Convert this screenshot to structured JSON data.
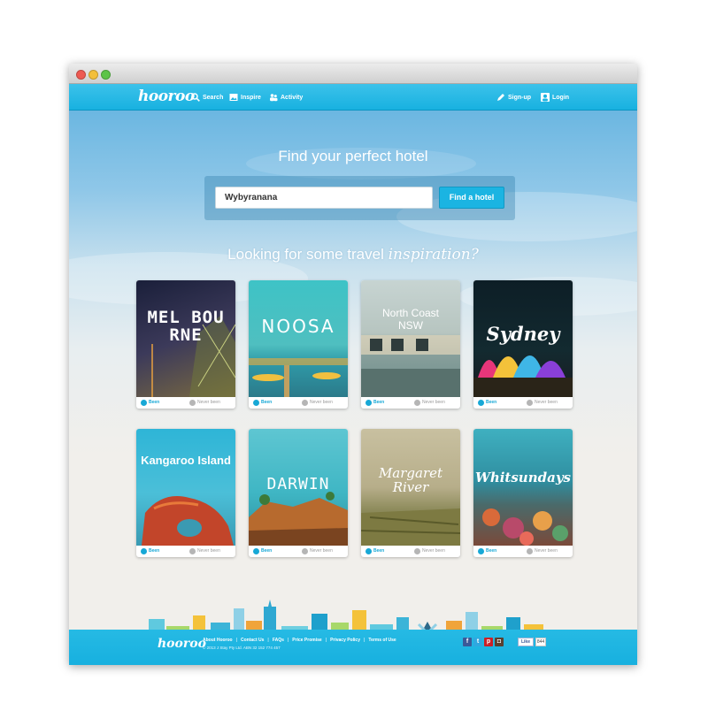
{
  "nav": {
    "logo": "hooroo",
    "search": "Search",
    "inspire": "Inspire",
    "activity": "Activity",
    "signup": "Sign-up",
    "login": "Login"
  },
  "hero": {
    "title": "Find your perfect hotel",
    "search_value": "Wybyranana",
    "button": "Find a hotel"
  },
  "inspire": {
    "prefix": "Looking for some travel ",
    "emph": "inspiration?"
  },
  "cards": [
    {
      "label": "MEL BOU RNE",
      "been": "Been",
      "never": "Never been"
    },
    {
      "label": "NOOSA",
      "been": "Been",
      "never": "Never been"
    },
    {
      "label": "North Coast NSW",
      "been": "Been",
      "never": "Never been"
    },
    {
      "label": "Sydney",
      "been": "Been",
      "never": "Never been"
    },
    {
      "label": "Kangaroo Island",
      "been": "Been",
      "never": "Never been"
    },
    {
      "label": "DARWIN",
      "been": "Been",
      "never": "Never been"
    },
    {
      "label": "Margaret River",
      "been": "Been",
      "never": "Never been"
    },
    {
      "label": "Whitsundays",
      "been": "Been",
      "never": "Never been"
    }
  ],
  "footer": {
    "logo": "hooroo",
    "links": [
      "About Hooroo",
      "Contact Us",
      "FAQs",
      "Price Promise",
      "Privacy Policy",
      "Terms of Use"
    ],
    "copyright": "© 2013 J Stay Pty Ltd. ABN 32 152 774 457",
    "like": "Like",
    "like_count": "844"
  },
  "colors": {
    "brand": "#1bb4e2",
    "been": "#17a8d6"
  }
}
